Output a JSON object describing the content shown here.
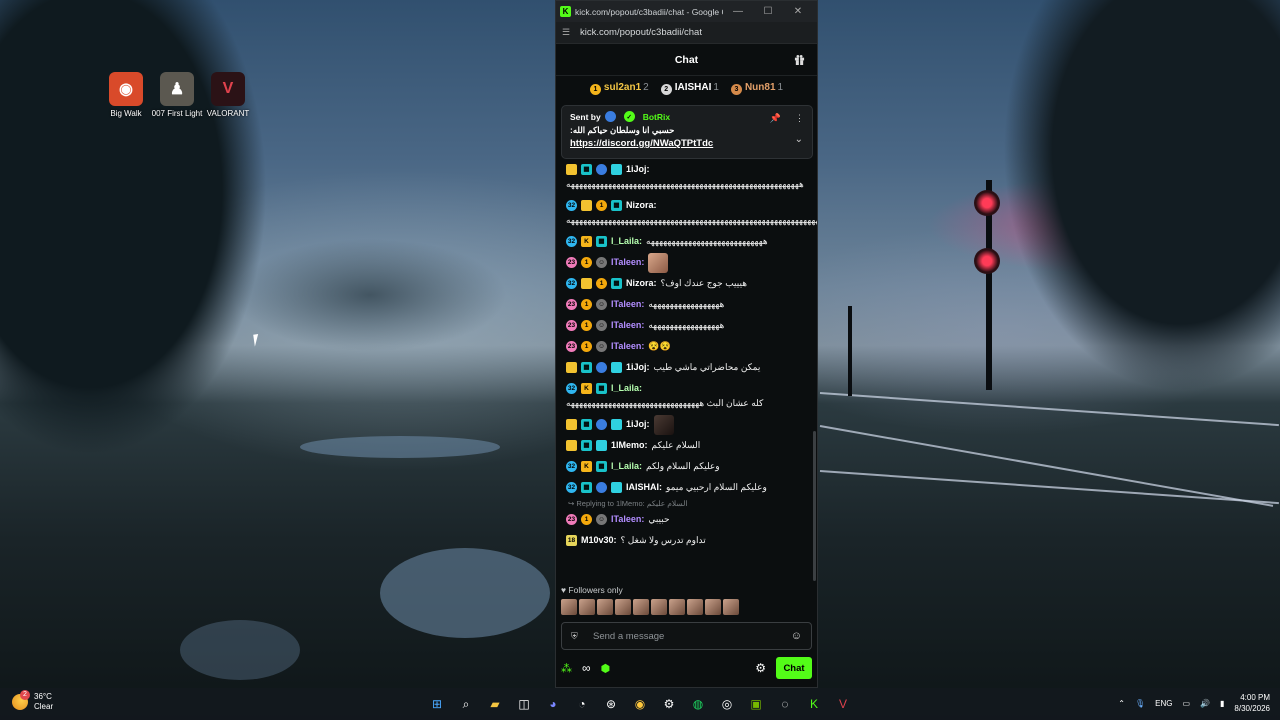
{
  "desktop": {
    "icons": [
      {
        "label": "Big Walk",
        "icon": "big-walk-icon",
        "color": "#d94a2a"
      },
      {
        "label": "007 First Light",
        "icon": "007-first-light-icon",
        "color": "#5b5850"
      },
      {
        "label": "VALORANT",
        "icon": "valorant-icon",
        "color": "#e0424d"
      }
    ]
  },
  "browser": {
    "title": "kick.com/popout/c3badii/chat - Google C...",
    "url": "kick.com/popout/c3badii/chat"
  },
  "chat": {
    "header": "Chat",
    "leaderboard": [
      {
        "rank": "1",
        "name": "sul2an1",
        "count": "2",
        "color": "#f3b41b",
        "name_color": "#f3c645"
      },
      {
        "rank": "2",
        "name": "IAISHAI",
        "count": "1",
        "color": "#d7d7d7",
        "name_color": "#ffffff"
      },
      {
        "rank": "3",
        "name": "Nun81",
        "count": "1",
        "color": "#d58a4a",
        "name_color": "#e3a06a"
      }
    ],
    "pinned": {
      "sent_by_label": "Sent by",
      "bot_name": "BotRix",
      "message": "حسبي انا وسلطان حياكم الله:",
      "link": "https://discord.gg/NWaQTPtTdc"
    },
    "messages": [
      {
        "user": "1iJoj",
        "color": "u-white",
        "badges": [
          "crown",
          "og",
          "moon",
          "sub"
        ],
        "text": "ههههههههههههههههههههههههههههههههههههههههههههههههههههههههه",
        "tall": true
      },
      {
        "user": "Nizora",
        "color": "u-white",
        "badges": [
          "sub32",
          "crown",
          "gold",
          "og"
        ],
        "text": "هههههههههههههههههههههههههههههههههههههههههههههههههههههههههههههههههههههههههههههه",
        "tall": true
      },
      {
        "user": "l_Laila",
        "color": "u-green",
        "badges": [
          "sub32",
          "k",
          "og"
        ],
        "text": "ههههههههههههههههههههههههههههه"
      },
      {
        "user": "ITaleen",
        "color": "u-purple",
        "badges": [
          "pink",
          "gold",
          "gray"
        ],
        "text": "",
        "emote": true
      },
      {
        "user": "Nizora",
        "color": "u-white",
        "badges": [
          "sub32",
          "crown",
          "gold",
          "og"
        ],
        "text": "هيييب جوج عندك اوف؟"
      },
      {
        "user": "ITaleen",
        "color": "u-purple",
        "badges": [
          "pink",
          "gold",
          "gray"
        ],
        "text": "هههههههههههههههههه"
      },
      {
        "user": "ITaleen",
        "color": "u-purple",
        "badges": [
          "pink",
          "gold",
          "gray"
        ],
        "text": "هههههههههههههههههه"
      },
      {
        "user": "ITaleen",
        "color": "u-purple",
        "badges": [
          "pink",
          "gold",
          "gray"
        ],
        "text": "😵😵"
      },
      {
        "user": "1iJoj",
        "color": "u-white",
        "badges": [
          "crown",
          "og",
          "moon",
          "sub"
        ],
        "text": "يمكن محاضراتي ماشي طيب"
      },
      {
        "user": "l_Laila",
        "color": "u-green",
        "badges": [
          "sub32",
          "k",
          "og"
        ],
        "text": "كله عشان البث ههههههههههههههههههههههههههههههههه",
        "tall": true
      },
      {
        "user": "1iJoj",
        "color": "u-white",
        "badges": [
          "crown",
          "og",
          "moon",
          "sub"
        ],
        "text": "",
        "emote": true,
        "emote_dark": true
      },
      {
        "user": "1lMemo",
        "color": "u-white",
        "badges": [
          "crown",
          "og",
          "sub"
        ],
        "text": "السلام عليكم"
      },
      {
        "user": "l_Laila",
        "color": "u-green",
        "badges": [
          "sub32",
          "k",
          "og"
        ],
        "text": "وعليكم السلام ولكم"
      },
      {
        "user": "IAISHAI",
        "color": "u-white",
        "badges": [
          "sub32",
          "og",
          "moon",
          "sub"
        ],
        "text": "وعليكم السلام ارحبيي ميمو"
      },
      {
        "reply": "Replying to 1lMemo: السلام عليكم"
      },
      {
        "user": "ITaleen",
        "color": "u-purple",
        "badges": [
          "pink",
          "gold",
          "gray"
        ],
        "text": "حبيبي"
      },
      {
        "user": "M10v30",
        "color": "u-white",
        "badges": [
          "b18"
        ],
        "text": "تداوم تدرس ولا شغل ؟"
      }
    ],
    "followers_only": "Followers only",
    "input_placeholder": "Send a message",
    "send_label": "Chat"
  },
  "taskbar": {
    "weather_temp": "36°C",
    "weather_desc": "Clear",
    "weather_badge": "2",
    "language": "ENG",
    "time": "4:00 PM",
    "date": "8/30/2026"
  }
}
